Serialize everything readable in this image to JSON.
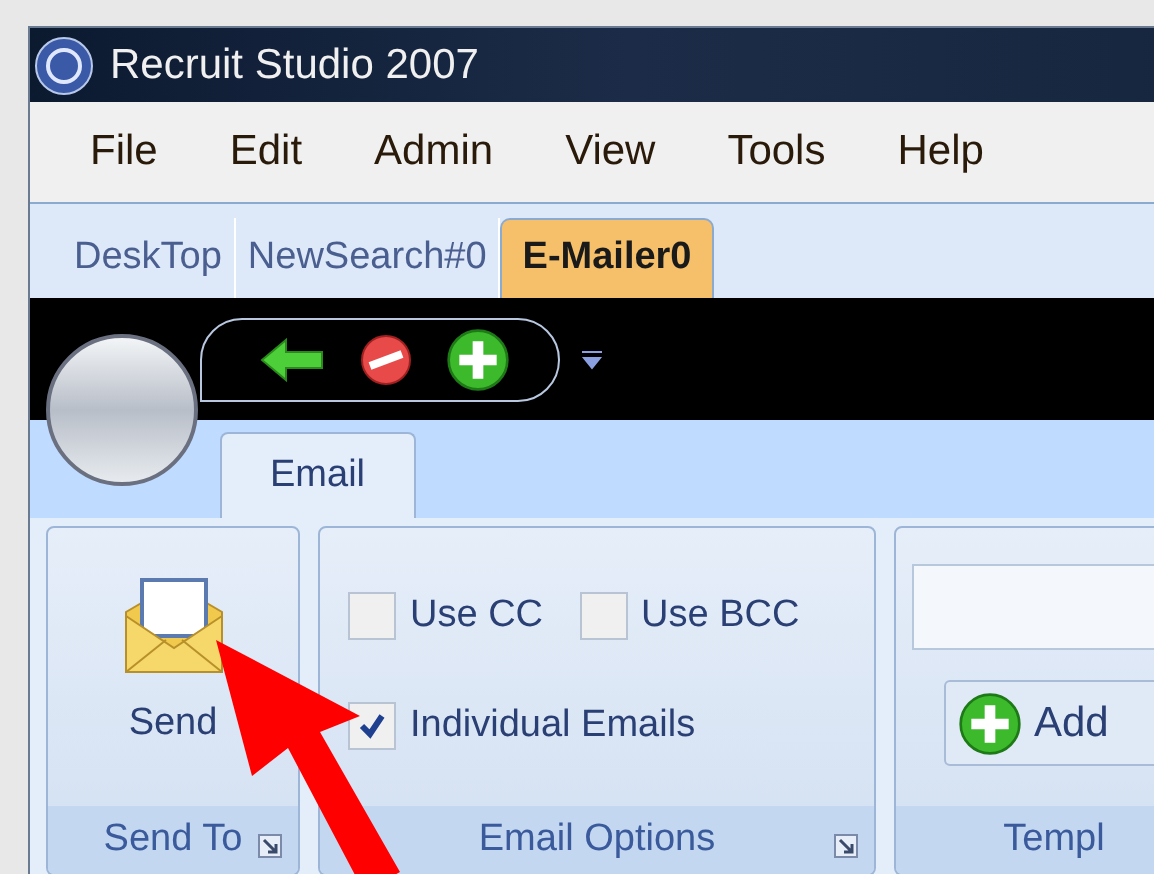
{
  "window": {
    "title": "Recruit Studio 2007"
  },
  "menu": [
    "File",
    "Edit",
    "Admin",
    "View",
    "Tools",
    "Help"
  ],
  "tabs": [
    {
      "label": "DeskTop",
      "selected": false
    },
    {
      "label": "NewSearch#0",
      "selected": false
    },
    {
      "label": "E-Mailer0",
      "selected": true
    }
  ],
  "ribbon_tabs": [
    {
      "label": "Email",
      "selected": true
    }
  ],
  "groups": [
    {
      "kind": "send",
      "title": "Send To",
      "button": "Send",
      "launcher": true
    },
    {
      "kind": "options",
      "title": "Email Options",
      "launcher": true,
      "checkboxes": [
        {
          "label": "Use CC",
          "checked": false
        },
        {
          "label": "Use BCC",
          "checked": false
        },
        {
          "label": "Individual Emails",
          "checked": true
        }
      ]
    },
    {
      "kind": "templates",
      "title": "Templ",
      "button": "Add",
      "launcher": false
    }
  ]
}
